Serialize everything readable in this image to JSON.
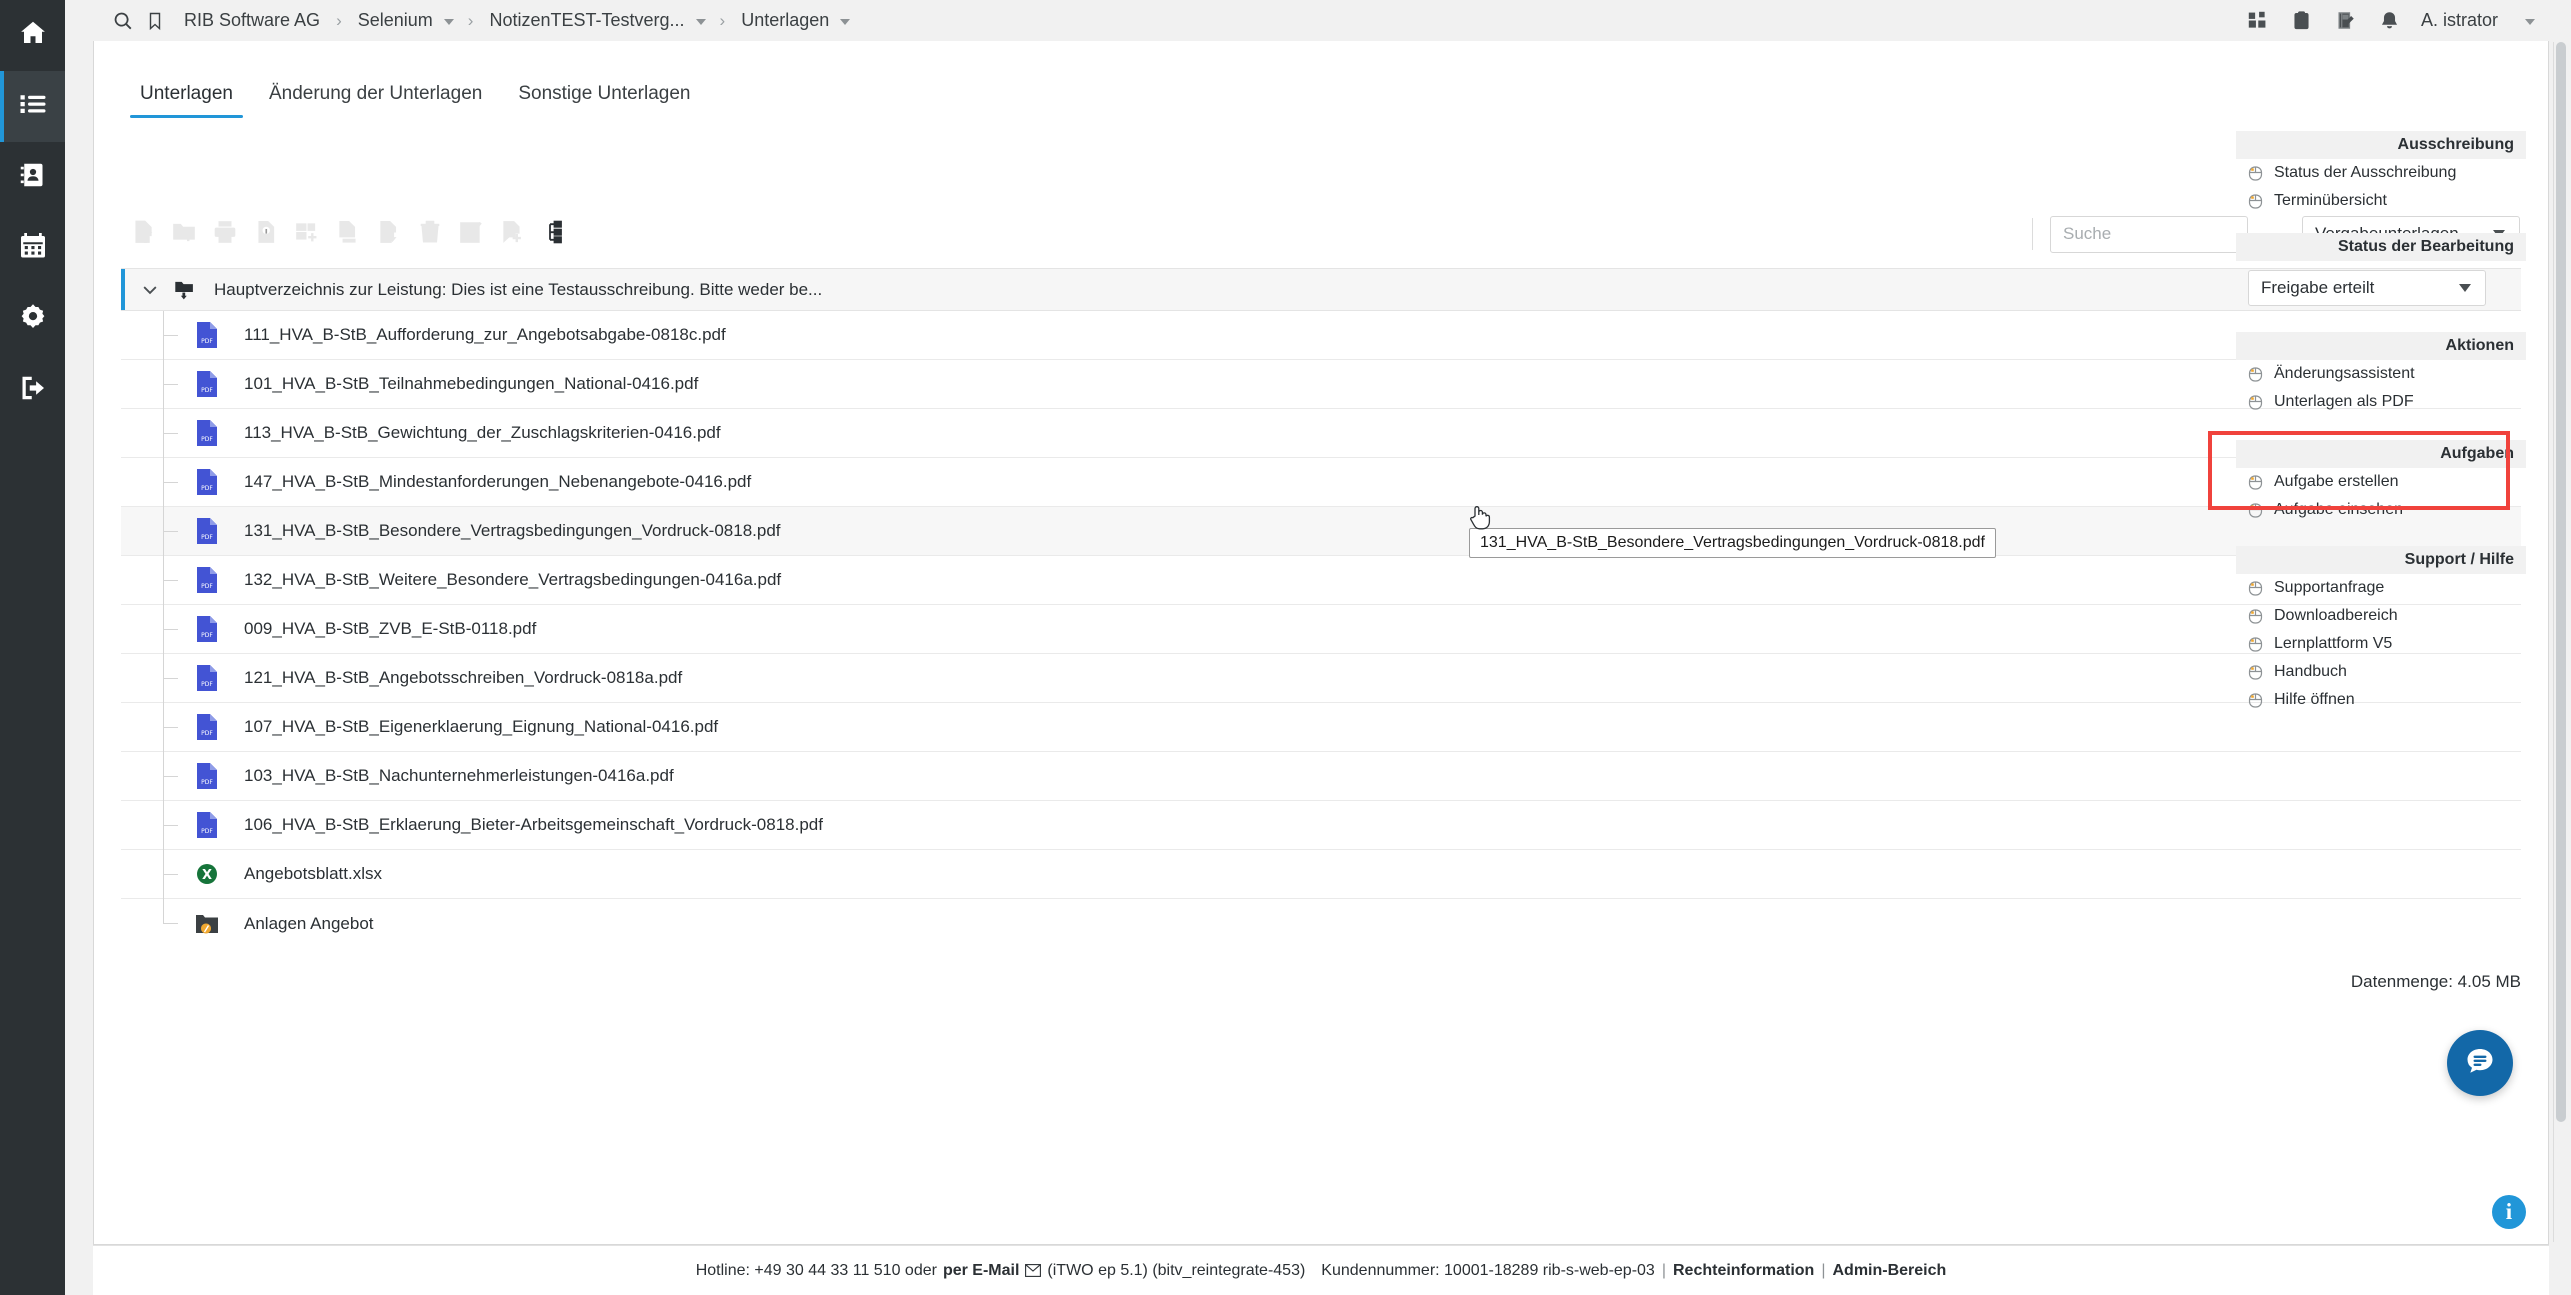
{
  "rail": {
    "items": [
      {
        "name": "home",
        "icon": "home-icon",
        "active": false
      },
      {
        "name": "projects",
        "icon": "list-icon",
        "active": true
      },
      {
        "name": "contacts",
        "icon": "address-book-icon",
        "active": false
      },
      {
        "name": "calendar",
        "icon": "calendar-icon",
        "active": false
      },
      {
        "name": "settings",
        "icon": "gear-icon",
        "active": false
      },
      {
        "name": "logout",
        "icon": "logout-icon",
        "active": false
      }
    ]
  },
  "topbar": {
    "search_icon": "search-icon",
    "bookmark_icon": "bookmark-icon",
    "breadcrumb": [
      {
        "label": "RIB Software AG",
        "caret": false
      },
      {
        "label": "Selenium",
        "caret": true
      },
      {
        "label": "NotizenTEST-Testverg...",
        "caret": true
      },
      {
        "label": "Unterlagen",
        "caret": true
      }
    ],
    "separator": "›",
    "icons": [
      "apps-icon",
      "clipboard-check-icon",
      "note-edit-icon",
      "bell-icon"
    ],
    "user": "A. istrator"
  },
  "tabs": [
    {
      "label": "Unterlagen",
      "active": true
    },
    {
      "label": "Änderung der Unterlagen",
      "active": false
    },
    {
      "label": "Sonstige Unterlagen",
      "active": false
    }
  ],
  "toolbar": {
    "buttons": [
      {
        "name": "upload-document-button",
        "icon": "document-upload-icon",
        "enabled": false
      },
      {
        "name": "new-folder-button",
        "icon": "folder-add-icon",
        "enabled": false
      },
      {
        "name": "print-button",
        "icon": "printer-icon",
        "enabled": false
      },
      {
        "name": "document-info-button",
        "icon": "document-info-icon",
        "enabled": false
      },
      {
        "name": "add-from-archive-button",
        "icon": "archive-add-icon",
        "enabled": false
      },
      {
        "name": "document-properties-button",
        "icon": "document-properties-icon",
        "enabled": false
      },
      {
        "name": "download-document-button",
        "icon": "document-download-icon",
        "enabled": false
      },
      {
        "name": "delete-button",
        "icon": "trash-icon",
        "enabled": false
      },
      {
        "name": "checklist-button",
        "icon": "checklist-icon",
        "enabled": false
      },
      {
        "name": "add-note-button",
        "icon": "note-add-icon",
        "enabled": false
      },
      {
        "name": "tree-view-button",
        "icon": "tree-hierarchy-icon",
        "enabled": true
      }
    ],
    "search_placeholder": "Suche",
    "search_value": "",
    "filter_value": "Vergabeunterlagen"
  },
  "tree": {
    "root": {
      "label": "Hauptverzeichnis zur Leistung: Dies ist eine Testausschreibung. Bitte weder be...",
      "icon": "folder-download-icon",
      "expanded": true
    },
    "rows": [
      {
        "label": "111_HVA_B-StB_Aufforderung_zur_Angebotsabgabe-0818c.pdf",
        "icon": "pdf-icon",
        "hovered": false
      },
      {
        "label": "101_HVA_B-StB_Teilnahmebedingungen_National-0416.pdf",
        "icon": "pdf-icon",
        "hovered": false
      },
      {
        "label": "113_HVA_B-StB_Gewichtung_der_Zuschlagskriterien-0416.pdf",
        "icon": "pdf-icon",
        "hovered": false
      },
      {
        "label": "147_HVA_B-StB_Mindestanforderungen_Nebenangebote-0416.pdf",
        "icon": "pdf-icon",
        "hovered": false
      },
      {
        "label": "131_HVA_B-StB_Besondere_Vertragsbedingungen_Vordruck-0818.pdf",
        "icon": "pdf-icon",
        "hovered": true
      },
      {
        "label": "132_HVA_B-StB_Weitere_Besondere_Vertragsbedingungen-0416a.pdf",
        "icon": "pdf-icon",
        "hovered": false
      },
      {
        "label": "009_HVA_B-StB_ZVB_E-StB-0118.pdf",
        "icon": "pdf-icon",
        "hovered": false
      },
      {
        "label": "121_HVA_B-StB_Angebotsschreiben_Vordruck-0818a.pdf",
        "icon": "pdf-icon",
        "hovered": false
      },
      {
        "label": "107_HVA_B-StB_Eigenerklaerung_Eignung_National-0416.pdf",
        "icon": "pdf-icon",
        "hovered": false
      },
      {
        "label": "103_HVA_B-StB_Nachunternehmerleistungen-0416a.pdf",
        "icon": "pdf-icon",
        "hovered": false
      },
      {
        "label": "106_HVA_B-StB_Erklaerung_Bieter-Arbeitsgemeinschaft_Vordruck-0818.pdf",
        "icon": "pdf-icon",
        "hovered": false
      },
      {
        "label": "Angebotsblatt.xlsx",
        "icon": "xlsx-icon",
        "hovered": false
      },
      {
        "label": "Anlagen Angebot",
        "icon": "folder-attachment-icon",
        "hovered": false
      }
    ],
    "datenmenge": "Datenmenge: 4.05 MB"
  },
  "tooltip": {
    "text": "131_HVA_B-StB_Besondere_Vertragsbedingungen_Vordruck-0818.pdf"
  },
  "rightpanel": {
    "sections": [
      {
        "title": "Ausschreibung",
        "highlight": false,
        "items": [
          {
            "label": "Status der Ausschreibung"
          },
          {
            "label": "Terminübersicht"
          }
        ]
      },
      {
        "title": "Status der Bearbeitung",
        "highlight": false,
        "select_value": "Freigabe erteilt",
        "items": []
      },
      {
        "title": "Aktionen",
        "highlight": false,
        "items": [
          {
            "label": "Änderungsassistent"
          },
          {
            "label": "Unterlagen als PDF"
          }
        ]
      },
      {
        "title": "Aufgaben",
        "highlight": true,
        "items": [
          {
            "label": "Aufgabe erstellen"
          },
          {
            "label": "Aufgabe einsehen"
          }
        ]
      },
      {
        "title": "Support / Hilfe",
        "highlight": false,
        "items": [
          {
            "label": "Supportanfrage"
          },
          {
            "label": "Downloadbereich"
          },
          {
            "label": "Lernplattform V5"
          },
          {
            "label": "Handbuch"
          },
          {
            "label": "Hilfe öffnen"
          }
        ]
      }
    ],
    "highlight_color": "#f0423c"
  },
  "fab": {
    "chat_icon": "chat-bubble-icon",
    "info_icon": "info-icon",
    "info_glyph": "i"
  },
  "footer": {
    "hotline": "Hotline: +49 30 44 33 11 510 oder",
    "email_link": "per E-Mail",
    "mail_icon": "envelope-icon",
    "version": "(iTWO ep 5.1) (bitv_reintegrate-453)",
    "customer": "Kundennummer: 10001-18289 rib-s-web-ep-03",
    "legal": "Rechteinformation",
    "admin": "Admin-Bereich",
    "pipe": "|"
  }
}
